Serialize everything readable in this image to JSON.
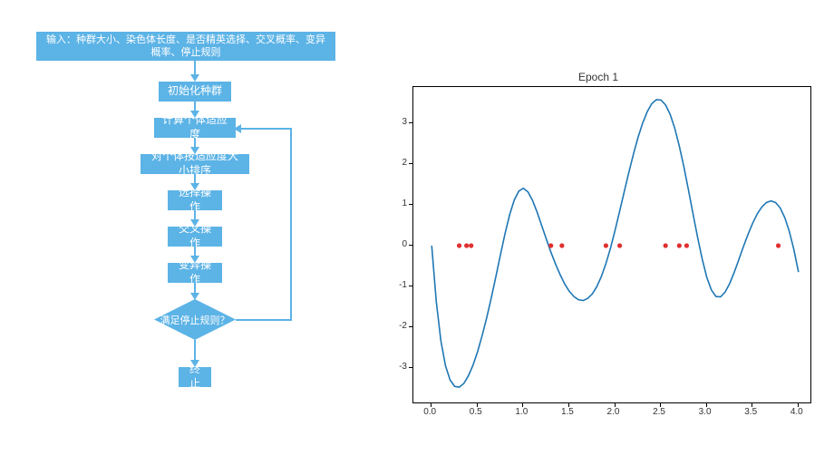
{
  "flowchart": {
    "input": "输入：种群大小、染色体长度、是否精英选择、交叉概率、变异概率、停止规则",
    "init": "初始化种群",
    "fitness": "计算个体适应度",
    "sort": "对个体按适应度大小排序",
    "select": "选择操作",
    "cross": "交叉操作",
    "mutate": "变异操作",
    "decision": "满足停止规则？",
    "end": "终止"
  },
  "chart_data": {
    "type": "line",
    "title": "Epoch 1",
    "xlabel": "",
    "ylabel": "",
    "xlim": [
      -0.2,
      4.15
    ],
    "ylim": [
      -3.9,
      3.9
    ],
    "xticks": [
      0.0,
      0.5,
      1.0,
      1.5,
      2.0,
      2.5,
      3.0,
      3.5,
      4.0
    ],
    "yticks": [
      -3,
      -2,
      -1,
      0,
      1,
      2,
      3
    ],
    "series": [
      {
        "name": "curve",
        "color": "#1f77b4",
        "type": "line",
        "x": [
          0.0,
          0.05,
          0.1,
          0.15,
          0.2,
          0.25,
          0.3,
          0.35,
          0.4,
          0.45,
          0.5,
          0.55,
          0.6,
          0.65,
          0.7,
          0.75,
          0.8,
          0.85,
          0.9,
          0.95,
          1.0,
          1.05,
          1.1,
          1.15,
          1.2,
          1.25,
          1.3,
          1.35,
          1.4,
          1.45,
          1.5,
          1.55,
          1.6,
          1.65,
          1.7,
          1.75,
          1.8,
          1.85,
          1.9,
          1.95,
          2.0,
          2.05,
          2.1,
          2.15,
          2.2,
          2.25,
          2.3,
          2.35,
          2.4,
          2.45,
          2.5,
          2.55,
          2.6,
          2.65,
          2.7,
          2.75,
          2.8,
          2.85,
          2.9,
          2.95,
          3.0,
          3.05,
          3.1,
          3.15,
          3.2,
          3.25,
          3.3,
          3.35,
          3.4,
          3.45,
          3.5,
          3.55,
          3.6,
          3.65,
          3.7,
          3.75,
          3.8,
          3.85,
          3.9,
          3.95,
          4.0
        ],
        "y": [
          0.0,
          -1.38,
          -2.34,
          -2.95,
          -3.3,
          -3.46,
          -3.48,
          -3.39,
          -3.2,
          -2.94,
          -2.61,
          -2.21,
          -1.77,
          -1.28,
          -0.76,
          -0.22,
          0.3,
          0.76,
          1.12,
          1.34,
          1.41,
          1.32,
          1.11,
          0.82,
          0.49,
          0.16,
          -0.16,
          -0.45,
          -0.71,
          -0.94,
          -1.12,
          -1.25,
          -1.33,
          -1.35,
          -1.3,
          -1.19,
          -1.01,
          -0.76,
          -0.44,
          -0.06,
          0.38,
          0.85,
          1.33,
          1.8,
          2.25,
          2.66,
          3.01,
          3.29,
          3.49,
          3.59,
          3.58,
          3.46,
          3.23,
          2.89,
          2.45,
          1.94,
          1.37,
          0.78,
          0.2,
          -0.33,
          -0.78,
          -1.09,
          -1.25,
          -1.26,
          -1.14,
          -0.93,
          -0.65,
          -0.34,
          -0.02,
          0.28,
          0.55,
          0.78,
          0.95,
          1.06,
          1.1,
          1.06,
          0.93,
          0.69,
          0.35,
          -0.1,
          -0.65
        ]
      },
      {
        "name": "points",
        "color": "#e03030",
        "type": "scatter",
        "x": [
          0.3,
          0.38,
          0.43,
          1.3,
          1.42,
          1.9,
          2.05,
          2.55,
          2.7,
          2.78,
          3.78
        ],
        "y": [
          0,
          0,
          0,
          0,
          0,
          0,
          0,
          0,
          0,
          0,
          0
        ]
      }
    ]
  }
}
